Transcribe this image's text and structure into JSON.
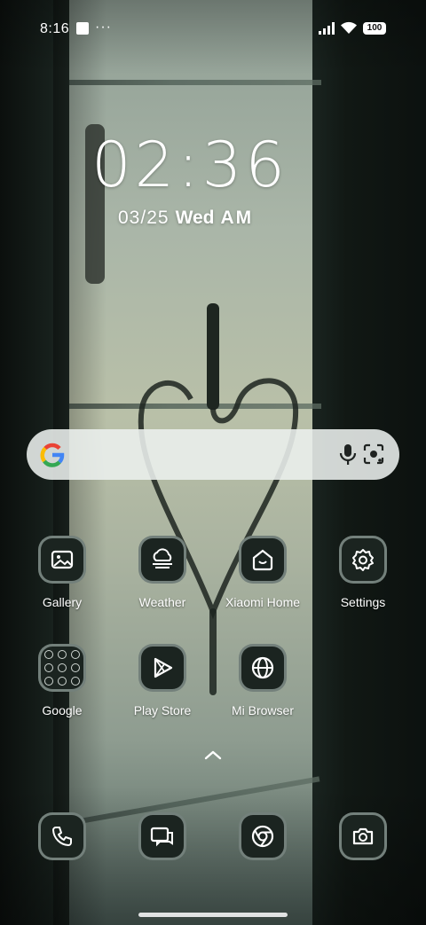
{
  "status_bar": {
    "time": "8:16",
    "more_indicator": "···",
    "battery": "100"
  },
  "clock": {
    "time": "02:36",
    "date": "03/25",
    "weekday": "Wed",
    "ampm": "AM"
  },
  "search": {
    "provider_icon": "google-g-icon",
    "mic_icon": "microphone-icon",
    "lens_icon": "camera-lens-icon"
  },
  "apps": [
    {
      "label": "Gallery",
      "icon": "gallery-icon"
    },
    {
      "label": "Weather",
      "icon": "weather-icon"
    },
    {
      "label": "Xiaomi Home",
      "icon": "home-icon"
    },
    {
      "label": "Settings",
      "icon": "gear-icon"
    },
    {
      "label": "Google",
      "icon": "folder-icon"
    },
    {
      "label": "Play Store",
      "icon": "play-store-icon"
    },
    {
      "label": "Mi Browser",
      "icon": "globe-icon"
    }
  ],
  "dock": [
    {
      "icon": "phone-icon"
    },
    {
      "icon": "messages-icon"
    },
    {
      "icon": "chrome-icon"
    },
    {
      "icon": "camera-icon"
    }
  ],
  "colors": {
    "icon_background": "#1b2420",
    "icon_border": "#82918c",
    "search_bar": "#ecf0ee",
    "google_blue": "#4285F4",
    "google_red": "#EA4335",
    "google_yellow": "#FBBC05",
    "google_green": "#34A853"
  }
}
